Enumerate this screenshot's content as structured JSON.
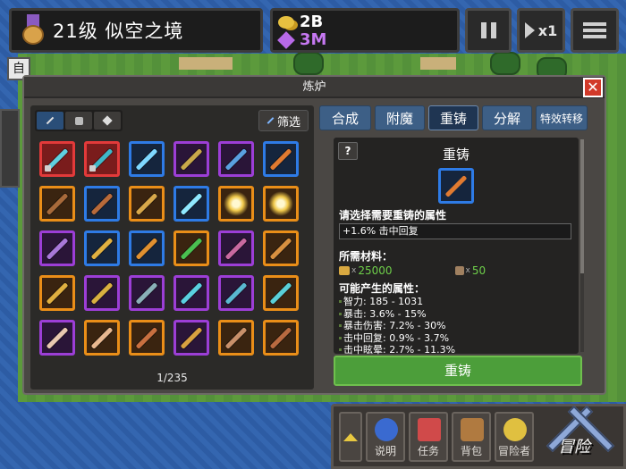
{
  "top": {
    "level_text": "21级 似空之境",
    "gold": "2B",
    "gems": "3M",
    "speed": "x1"
  },
  "side": {
    "tab_label": "自"
  },
  "dialog": {
    "title": "炼炉",
    "close_label": "✕",
    "filter_label": "筛选",
    "counter": "1/235",
    "items": [
      {
        "rarity": "red",
        "color": "#5fd0e0",
        "locked": true
      },
      {
        "rarity": "red",
        "color": "#3fb8c8",
        "locked": true
      },
      {
        "rarity": "blue",
        "color": "#7fd8ff",
        "locked": false
      },
      {
        "rarity": "purple",
        "color": "#c8a84a",
        "locked": false
      },
      {
        "rarity": "purple",
        "color": "#5aa0e0",
        "locked": false
      },
      {
        "rarity": "blue",
        "color": "#e07a30",
        "locked": false
      },
      {
        "rarity": "orange",
        "color": "#a86a3a",
        "locked": false
      },
      {
        "rarity": "blue",
        "color": "#b86a3a",
        "locked": false
      },
      {
        "rarity": "orange",
        "color": "#d8a84a",
        "locked": false
      },
      {
        "rarity": "blue",
        "color": "#8fe8ff",
        "locked": false
      },
      {
        "rarity": "orange",
        "color": "burst",
        "locked": false
      },
      {
        "rarity": "orange",
        "color": "burst",
        "locked": false
      },
      {
        "rarity": "purple",
        "color": "#a878d8",
        "locked": false
      },
      {
        "rarity": "blue",
        "color": "#e0b040",
        "locked": false
      },
      {
        "rarity": "blue",
        "color": "#e09030",
        "locked": false
      },
      {
        "rarity": "orange",
        "color": "#4ac050",
        "locked": false
      },
      {
        "rarity": "purple",
        "color": "#c86aa0",
        "locked": false
      },
      {
        "rarity": "orange",
        "color": "#d89040",
        "locked": false
      },
      {
        "rarity": "orange",
        "color": "#e0b040",
        "locked": false
      },
      {
        "rarity": "purple",
        "color": "#d8b040",
        "locked": false
      },
      {
        "rarity": "purple",
        "color": "#8ab0b8",
        "locked": false
      },
      {
        "rarity": "purple",
        "color": "#5ad0e0",
        "locked": false
      },
      {
        "rarity": "purple",
        "color": "#5ab8d0",
        "locked": false
      },
      {
        "rarity": "orange",
        "color": "#5ad0d8",
        "locked": false
      },
      {
        "rarity": "purple",
        "color": "#e8c8b0",
        "locked": false
      },
      {
        "rarity": "orange",
        "color": "#e8b890",
        "locked": false
      },
      {
        "rarity": "orange",
        "color": "#c87040",
        "locked": false
      },
      {
        "rarity": "purple",
        "color": "#d8a040",
        "locked": false
      },
      {
        "rarity": "orange",
        "color": "#c8906a",
        "locked": false
      },
      {
        "rarity": "orange",
        "color": "#b86a40",
        "locked": false
      }
    ],
    "tabs": [
      "合成",
      "附魔",
      "重铸",
      "分解",
      "特效转移"
    ],
    "active_tab_index": 2,
    "panel": {
      "help": "?",
      "title": "重铸",
      "select_label": "请选择需要重铸的属性",
      "selected_attr": "+1.6% 击中回复",
      "materials_label": "所需材料：",
      "mat_x": "x",
      "gold_cost": "25000",
      "item_cost": "50",
      "possible_label": "可能产生的属性：",
      "possible": [
        "智力: 185 - 1031",
        "暴击: 3.6% - 15%",
        "暴击伤害: 7.2% - 30%",
        "击中回复: 0.9% - 3.7%",
        "击中眩晕: 2.7% - 11.3%"
      ],
      "action": "重铸"
    }
  },
  "bottom": {
    "buttons": [
      {
        "label": "说明",
        "color": "#3a6ad0"
      },
      {
        "label": "任务",
        "color": "#d04a4a"
      },
      {
        "label": "背包",
        "color": "#b07a40"
      },
      {
        "label": "冒险者",
        "color": "#e0c040"
      }
    ],
    "adventure": "冒险"
  }
}
